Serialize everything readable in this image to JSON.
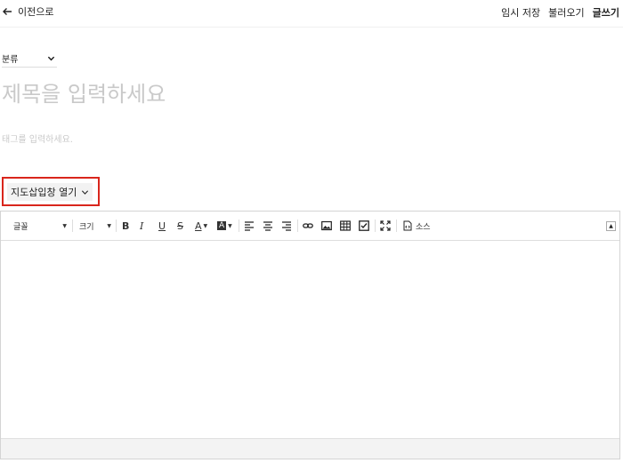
{
  "header": {
    "back_label": "이전으로",
    "temp_save": "임시 저장",
    "load": "불러오기",
    "write": "글쓰기"
  },
  "category": {
    "selected": "분류"
  },
  "title": {
    "placeholder": "제목을 입력하세요",
    "value": ""
  },
  "tags": {
    "placeholder": "태그를 입력하세요.",
    "value": ""
  },
  "map_toggle": {
    "label": "지도삽입창 열기"
  },
  "toolbar": {
    "font_label": "글꼴",
    "size_label": "크기",
    "source_label": "소스"
  },
  "colors": {
    "highlight_border": "#d9261c"
  }
}
